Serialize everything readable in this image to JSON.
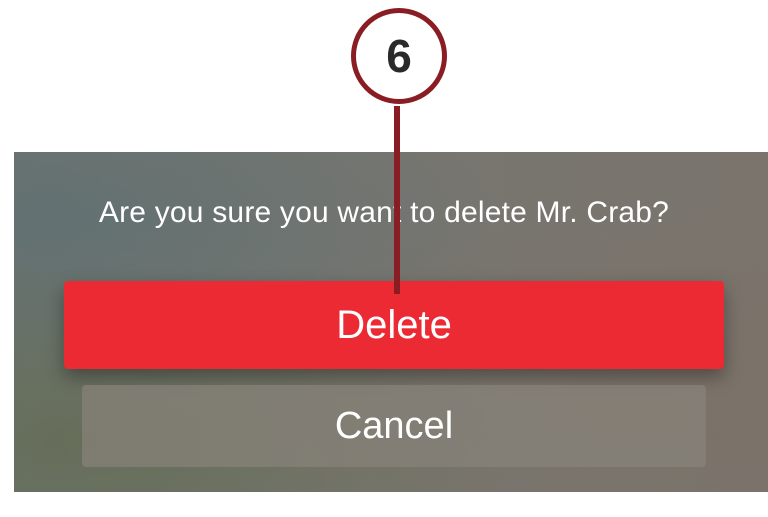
{
  "dialog": {
    "message": "Are you sure you want to delete Mr. Crab?",
    "delete_label": "Delete",
    "cancel_label": "Cancel"
  },
  "callout": {
    "step_number": "6"
  },
  "colors": {
    "delete_button": "#ec2a33",
    "callout_accent": "#8a1c24",
    "text": "#ffffff"
  }
}
